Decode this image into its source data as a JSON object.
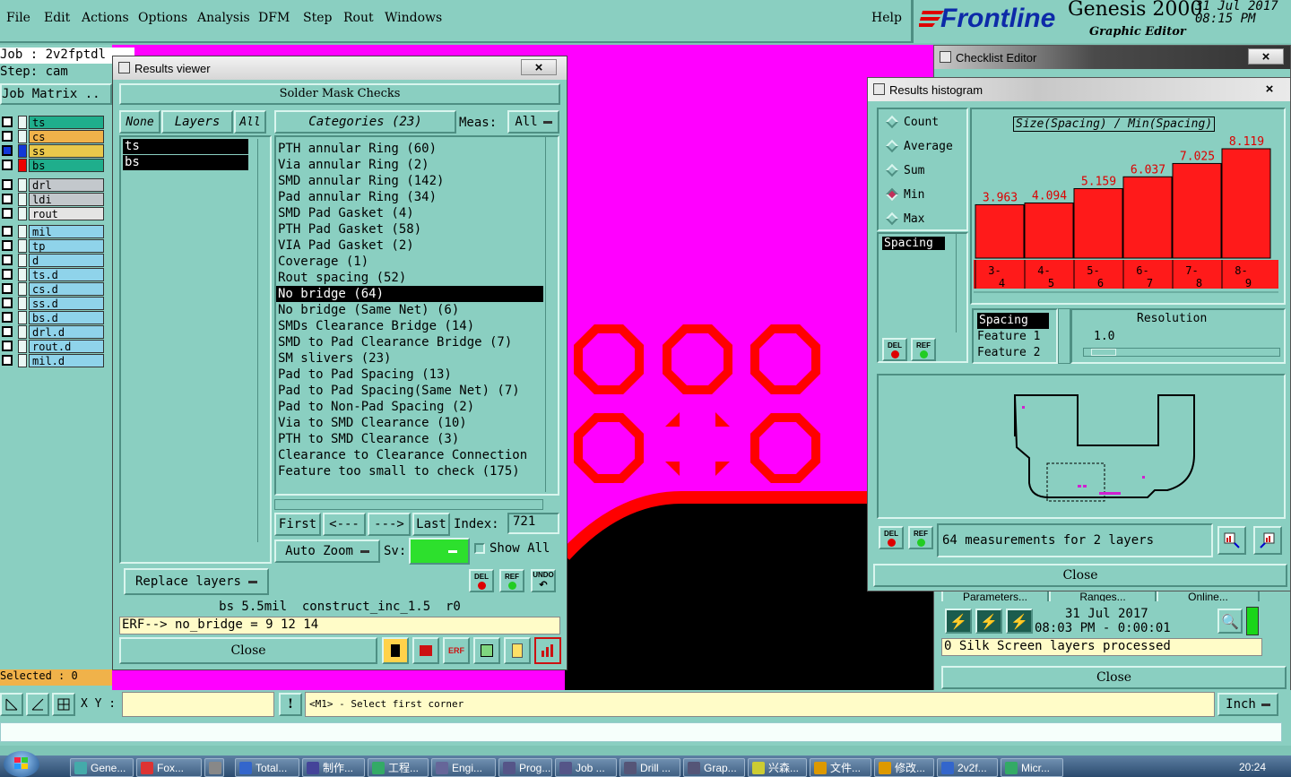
{
  "menubar": {
    "items": [
      "File",
      "Edit",
      "Actions",
      "Options",
      "Analysis",
      "DFM",
      "Step",
      "Rout",
      "Windows"
    ],
    "help": "Help",
    "brand_logo": "Frontline",
    "product": "Genesis 2000",
    "subtitle": "Graphic Editor",
    "date": "31 Jul 2017",
    "time": "08:15 PM"
  },
  "job_panel": {
    "job": "Job : 2v2fptdl",
    "step": "Step: cam",
    "matrix": "Job Matrix ..",
    "layers": [
      {
        "name": "ts",
        "color": "#1fae8c"
      },
      {
        "name": "cs",
        "color": "#f0b24a"
      },
      {
        "name": "ss",
        "color": "#e9c84b"
      },
      {
        "name": "bs",
        "color": "#1fae8c"
      },
      {
        "name": "drl",
        "color": "#c3c8cc"
      },
      {
        "name": "ldi",
        "color": "#c3c8cc"
      },
      {
        "name": "rout",
        "color": "#e4e4e4"
      },
      {
        "name": "mil",
        "color": "#8fd3ea"
      },
      {
        "name": "tp",
        "color": "#8fd3ea"
      },
      {
        "name": "d",
        "color": "#8fd3ea"
      },
      {
        "name": "ts.d",
        "color": "#8fd3ea"
      },
      {
        "name": "cs.d",
        "color": "#8fd3ea"
      },
      {
        "name": "ss.d",
        "color": "#8fd3ea"
      },
      {
        "name": "bs.d",
        "color": "#8fd3ea"
      },
      {
        "name": "drl.d",
        "color": "#8fd3ea"
      },
      {
        "name": "rout.d",
        "color": "#8fd3ea"
      },
      {
        "name": "mil.d",
        "color": "#8fd3ea"
      }
    ],
    "selected": "Selected : 0"
  },
  "results_viewer": {
    "title": "Results viewer",
    "close_x": "×",
    "heading": "Solder Mask Checks",
    "layer_tabs": {
      "none": "None",
      "layers": "Layers",
      "all": "All"
    },
    "layer_list": [
      "ts",
      "bs"
    ],
    "categories_label": "Categories (23)",
    "meas_label": "Meas:",
    "meas_value": "All",
    "categories": [
      "PTH annular Ring (60)",
      "Via annular Ring (2)",
      "SMD annular Ring (142)",
      "Pad annular Ring (34)",
      "SMD Pad Gasket (4)",
      "PTH Pad Gasket (58)",
      "VIA Pad Gasket (2)",
      "Coverage (1)",
      "Rout spacing (52)",
      "No bridge (64)",
      "No bridge (Same Net) (6)",
      "SMDs Clearance Bridge (14)",
      "SMD to Pad Clearance Bridge (7)",
      "SM slivers (23)",
      "Pad to Pad Spacing (13)",
      "Pad to Pad Spacing(Same Net) (7)",
      "Pad to Non-Pad Spacing (2)",
      "Via to SMD Clearance (10)",
      "PTH to SMD Clearance (3)",
      "Clearance to Clearance Connection",
      "Feature too small to check (175)"
    ],
    "selected_index": 9,
    "nav": {
      "first": "First",
      "prev": "<---",
      "next": "--->",
      "last": "Last",
      "index_label": "Index:",
      "index_value": "721"
    },
    "auto_zoom": "Auto Zoom",
    "sv_label": "Sv:",
    "show_all": "Show All",
    "replace_layers": "Replace layers",
    "del": "DEL",
    "ref": "REF",
    "undo": "UNDO",
    "status_line": "bs 5.5mil  construct_inc_1.5  r0",
    "erf_line": "ERF--> no_bridge = 9 12 14",
    "close": "Close"
  },
  "checklist_editor": {
    "title": "Checklist Editor",
    "params_tabs": [
      "Parameters...",
      "Ranges...",
      "Online..."
    ],
    "run_date": "31 Jul 2017",
    "run_time": "08:03 PM - 0:00:01",
    "status": "0 Silk Screen layers processed",
    "close": "Close"
  },
  "histogram": {
    "title": "Results histogram",
    "modes": [
      "Count",
      "Average",
      "Sum",
      "Min",
      "Max"
    ],
    "active_mode": "Min",
    "list_items": [
      "Spacing"
    ],
    "chart_title": "Size(Spacing) / Min(Spacing)",
    "resolution_label": "Resolution",
    "resolution_value": "1.0",
    "res_list": [
      "Spacing",
      "Feature 1",
      "Feature 2"
    ],
    "measurements": "64 measurements for 2 layers",
    "close": "Close"
  },
  "chart_data": {
    "type": "bar",
    "title": "Size(Spacing) / Min(Spacing)",
    "categories": [
      "3-4",
      "4-5",
      "5-6",
      "6-7",
      "7-8",
      "8-9"
    ],
    "values": [
      3.963,
      4.094,
      5.159,
      6.037,
      7.025,
      8.119
    ],
    "value_labels": [
      "3.963",
      "4.094",
      "5.159",
      "6.037",
      "7.025",
      "8.119"
    ],
    "bar_color": "#ff1a1a"
  },
  "bottom": {
    "xy_label": "X Y :",
    "prompt": "<M1> - Select first corner",
    "units": "Inch"
  },
  "taskbar": {
    "items": [
      "Gene...",
      "Fox...",
      "Total...",
      "制作...",
      "工程...",
      "Engi...",
      "Prog...",
      "Job ...",
      "Drill ...",
      "Grap...",
      "兴森...",
      "文件...",
      "修改...",
      "2v2f...",
      "Micr..."
    ],
    "clock": "20:24"
  },
  "colors": {
    "teal": "#8acfc1",
    "magenta": "#ff00ff",
    "pad_red": "#ff0000"
  }
}
